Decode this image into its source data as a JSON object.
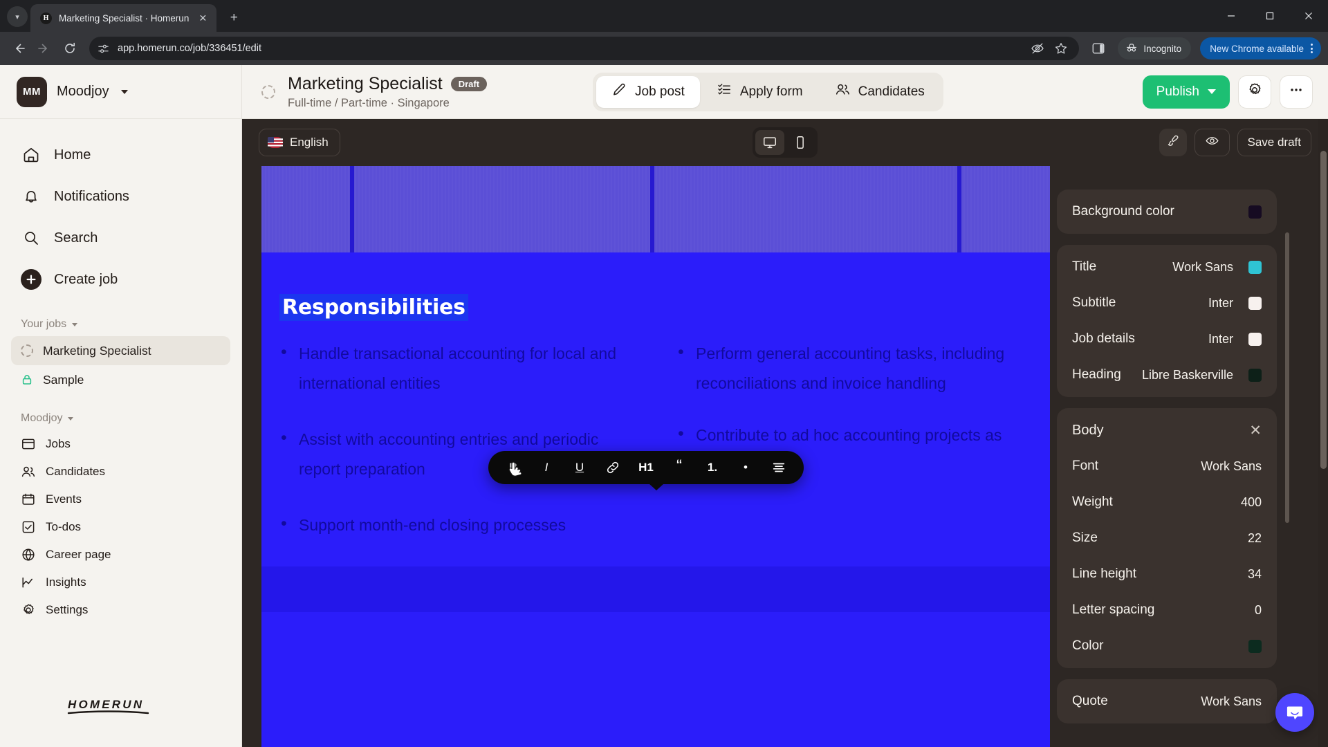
{
  "browser": {
    "tab": {
      "title": "Marketing Specialist · Homerun",
      "favicon_letter": "H"
    },
    "new_tab_label": "+",
    "tab_list_icon": "chevron-down-icon",
    "close_tab_icon": "close-icon",
    "window": {
      "minimize": "minimize-icon",
      "maximize": "maximize-icon",
      "close": "close-icon"
    },
    "nav": {
      "back": "back-arrow-icon",
      "forward": "forward-arrow-icon",
      "reload": "reload-icon"
    },
    "omnibox": {
      "url": "app.homerun.co/job/336451/edit",
      "site_icon": "site-settings-icon",
      "tracking_icon": "eye-slash-icon",
      "bookmark_icon": "star-icon"
    },
    "side_panel_icon": "side-panel-icon",
    "incognito_label": "Incognito",
    "incognito_icon": "incognito-hat-icon",
    "update_label": "New Chrome available",
    "menu_icon": "kebab-menu-icon",
    "update_color": "#0b57a4"
  },
  "sidebar": {
    "org": {
      "initials": "MM",
      "name": "Moodjoy",
      "caret": "chevron-down-icon"
    },
    "nav": [
      {
        "label": "Home",
        "icon": "home-icon"
      },
      {
        "label": "Notifications",
        "icon": "bell-icon"
      },
      {
        "label": "Search",
        "icon": "search-icon"
      },
      {
        "label": "Create job",
        "icon": "plus-circle-icon"
      }
    ],
    "your_jobs": {
      "label": "Your jobs",
      "items": [
        {
          "label": "Marketing Specialist",
          "icon": "dashed-circle-icon",
          "active": true
        },
        {
          "label": "Sample",
          "icon": "lock-icon",
          "active": false
        }
      ]
    },
    "org_section": {
      "label": "Moodjoy",
      "items": [
        {
          "label": "Jobs",
          "icon": "board-icon"
        },
        {
          "label": "Candidates",
          "icon": "people-icon"
        },
        {
          "label": "Events",
          "icon": "calendar-icon"
        },
        {
          "label": "To-dos",
          "icon": "checkbox-icon"
        },
        {
          "label": "Career page",
          "icon": "globe-icon"
        },
        {
          "label": "Insights",
          "icon": "chart-line-icon"
        },
        {
          "label": "Settings",
          "icon": "gear-icon"
        }
      ]
    },
    "brand": "HOMERUN"
  },
  "job_header": {
    "status_icon": "dashed-circle-icon",
    "title": "Marketing Specialist",
    "badge": "Draft",
    "subtitle": "Full-time / Part-time · Singapore",
    "tabs": [
      {
        "label": "Job post",
        "icon": "pencil-icon",
        "active": true
      },
      {
        "label": "Apply form",
        "icon": "checklist-icon",
        "active": false
      },
      {
        "label": "Candidates",
        "icon": "people-icon",
        "active": false
      }
    ],
    "publish_label": "Publish",
    "publish_caret": "chevron-down-icon",
    "publish_color": "#1dbf73",
    "settings_icon": "gear-icon",
    "more_icon": "ellipsis-icon"
  },
  "preview_bar": {
    "language": "English",
    "language_flag": "us-flag-icon",
    "device_desktop_icon": "desktop-icon",
    "device_mobile_icon": "mobile-icon",
    "active_device": "desktop",
    "brush_icon": "paintbrush-icon",
    "eye_icon": "eye-icon",
    "save_draft_label": "Save draft"
  },
  "format_toolbar": {
    "buttons": [
      {
        "label": "B",
        "name": "bold-button",
        "active": true
      },
      {
        "label": "I",
        "name": "italic-button",
        "active": false
      },
      {
        "label": "U",
        "name": "underline-button",
        "active": false
      },
      {
        "label": "link",
        "name": "link-icon",
        "active": false
      },
      {
        "label": "H1",
        "name": "heading-one-button",
        "active": false
      },
      {
        "label": "“",
        "name": "blockquote-button",
        "active": false
      },
      {
        "label": "1.",
        "name": "ordered-list-button",
        "active": false
      },
      {
        "label": "•",
        "name": "bullet-list-button",
        "active": false
      },
      {
        "label": "align",
        "name": "align-icon",
        "active": false
      }
    ]
  },
  "job_post": {
    "banner_color": "#5b4fd6",
    "background_color": "#2b1dfa",
    "heading": "Responsibilities",
    "heading_selected": true,
    "left_column": [
      "Handle transactional accounting for local and international entities",
      "Assist with accounting entries and periodic report preparation",
      "Support month-end closing processes"
    ],
    "right_column": [
      "Perform general accounting tasks, including reconciliations and invoice handling",
      "Contribute to ad hoc accounting projects as needed"
    ]
  },
  "style_panel": {
    "background": {
      "label": "Background color",
      "swatch": "#160b22"
    },
    "typography": [
      {
        "label": "Title",
        "value": "Work Sans",
        "swatch": "#2fc4d4"
      },
      {
        "label": "Subtitle",
        "value": "Inter",
        "swatch": "#f7f1ee"
      },
      {
        "label": "Job details",
        "value": "Inter",
        "swatch": "#f7f1ee"
      },
      {
        "label": "Heading",
        "value": "Libre Baskerville",
        "swatch": "#0d2018"
      }
    ],
    "body": {
      "title": "Body",
      "close_icon": "close-icon",
      "rows": [
        {
          "label": "Font",
          "value": "Work Sans"
        },
        {
          "label": "Weight",
          "value": "400"
        },
        {
          "label": "Size",
          "value": "22"
        },
        {
          "label": "Line height",
          "value": "34"
        },
        {
          "label": "Letter spacing",
          "value": "0"
        }
      ],
      "color_label": "Color",
      "color_swatch": "#0c2b1f"
    },
    "quote": {
      "label": "Quote",
      "value": "Work Sans"
    },
    "chat_icon": "chat-bubble-icon"
  }
}
